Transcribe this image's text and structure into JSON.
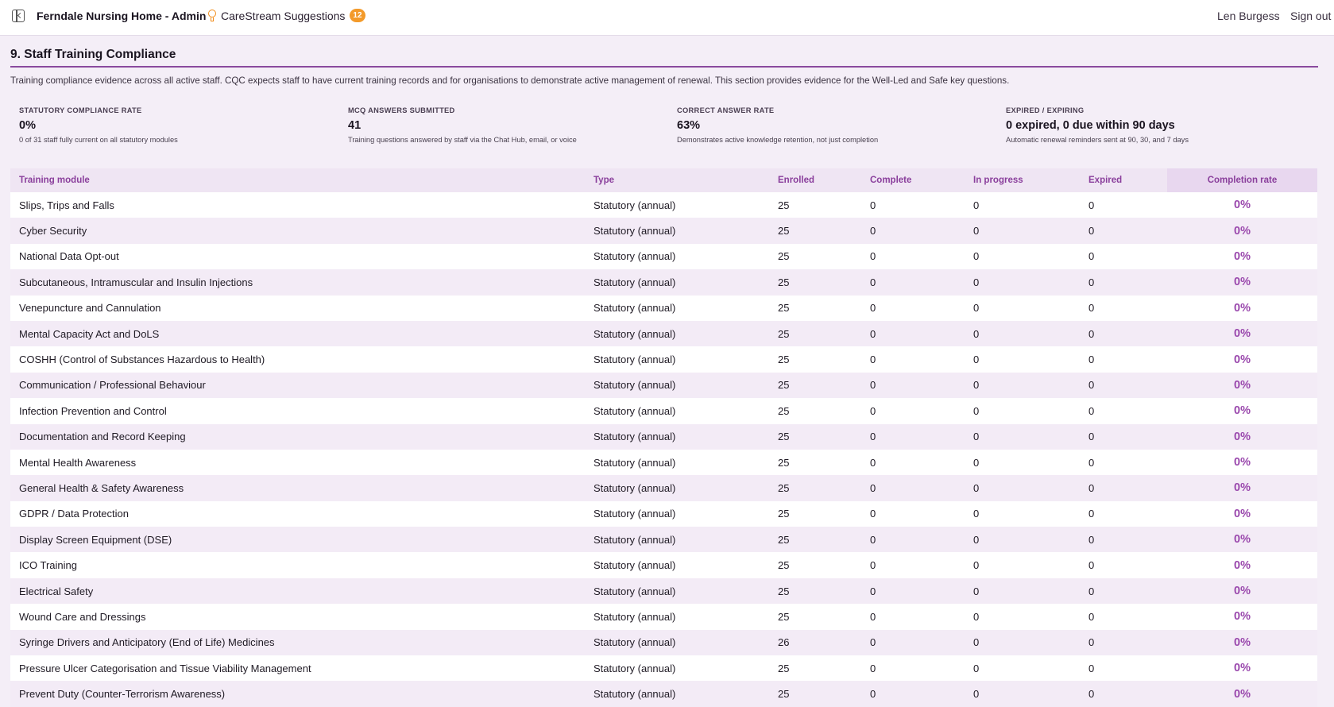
{
  "header": {
    "app_title": "Ferndale Nursing Home - Admin",
    "suggestions_label": "CareStream Suggestions",
    "suggestions_count": "12",
    "user_name": "Len Burgess",
    "sign_out": "Sign out"
  },
  "section": {
    "title": "9. Staff Training Compliance",
    "description": "Training compliance evidence across all active staff. CQC expects staff to have current training records and for organisations to demonstrate active management of renewal. This section provides evidence for the Well-Led and Safe key questions."
  },
  "stats": [
    {
      "label": "STATUTORY COMPLIANCE RATE",
      "value": "0%",
      "note": "0 of 31 staff fully current on all statutory modules"
    },
    {
      "label": "MCQ ANSWERS SUBMITTED",
      "value": "41",
      "note": "Training questions answered by staff via the Chat Hub, email, or voice"
    },
    {
      "label": "CORRECT ANSWER RATE",
      "value": "63%",
      "note": "Demonstrates active knowledge retention, not just completion"
    },
    {
      "label": "EXPIRED / EXPIRING",
      "value": "0 expired, 0 due within 90 days",
      "note": "Automatic renewal reminders sent at 90, 30, and 7 days"
    }
  ],
  "table": {
    "headers": [
      "Training module",
      "Type",
      "Enrolled",
      "Complete",
      "In progress",
      "Expired",
      "Completion rate"
    ],
    "rows": [
      [
        "Slips, Trips and Falls",
        "Statutory (annual)",
        "25",
        "0",
        "0",
        "0",
        "0%"
      ],
      [
        "Cyber Security",
        "Statutory (annual)",
        "25",
        "0",
        "0",
        "0",
        "0%"
      ],
      [
        "National Data Opt-out",
        "Statutory (annual)",
        "25",
        "0",
        "0",
        "0",
        "0%"
      ],
      [
        "Subcutaneous, Intramuscular and Insulin Injections",
        "Statutory (annual)",
        "25",
        "0",
        "0",
        "0",
        "0%"
      ],
      [
        "Venepuncture and Cannulation",
        "Statutory (annual)",
        "25",
        "0",
        "0",
        "0",
        "0%"
      ],
      [
        "Mental Capacity Act and DoLS",
        "Statutory (annual)",
        "25",
        "0",
        "0",
        "0",
        "0%"
      ],
      [
        "COSHH (Control of Substances Hazardous to Health)",
        "Statutory (annual)",
        "25",
        "0",
        "0",
        "0",
        "0%"
      ],
      [
        "Communication / Professional Behaviour",
        "Statutory (annual)",
        "25",
        "0",
        "0",
        "0",
        "0%"
      ],
      [
        "Infection Prevention and Control",
        "Statutory (annual)",
        "25",
        "0",
        "0",
        "0",
        "0%"
      ],
      [
        "Documentation and Record Keeping",
        "Statutory (annual)",
        "25",
        "0",
        "0",
        "0",
        "0%"
      ],
      [
        "Mental Health Awareness",
        "Statutory (annual)",
        "25",
        "0",
        "0",
        "0",
        "0%"
      ],
      [
        "General Health & Safety Awareness",
        "Statutory (annual)",
        "25",
        "0",
        "0",
        "0",
        "0%"
      ],
      [
        "GDPR / Data Protection",
        "Statutory (annual)",
        "25",
        "0",
        "0",
        "0",
        "0%"
      ],
      [
        "Display Screen Equipment (DSE)",
        "Statutory (annual)",
        "25",
        "0",
        "0",
        "0",
        "0%"
      ],
      [
        "ICO Training",
        "Statutory (annual)",
        "25",
        "0",
        "0",
        "0",
        "0%"
      ],
      [
        "Electrical Safety",
        "Statutory (annual)",
        "25",
        "0",
        "0",
        "0",
        "0%"
      ],
      [
        "Wound Care and Dressings",
        "Statutory (annual)",
        "25",
        "0",
        "0",
        "0",
        "0%"
      ],
      [
        "Syringe Drivers and Anticipatory (End of Life) Medicines",
        "Statutory (annual)",
        "26",
        "0",
        "0",
        "0",
        "0%"
      ],
      [
        "Pressure Ulcer Categorisation and Tissue Viability Management",
        "Statutory (annual)",
        "25",
        "0",
        "0",
        "0",
        "0%"
      ],
      [
        "Prevent Duty (Counter-Terrorism Awareness)",
        "Statutory (annual)",
        "25",
        "0",
        "0",
        "0",
        "0%"
      ]
    ]
  }
}
